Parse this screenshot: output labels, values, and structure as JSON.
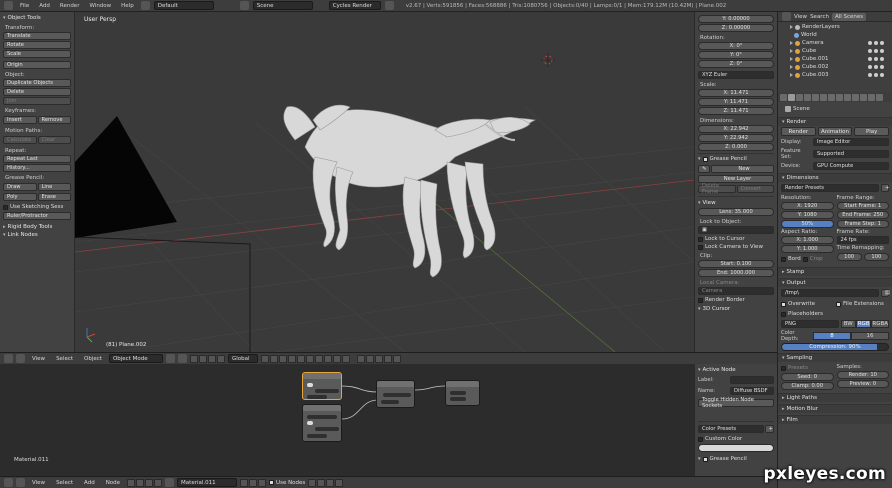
{
  "top_bar": {
    "menus": [
      "File",
      "Add",
      "Render",
      "Window",
      "Help"
    ],
    "layout": "Default",
    "scene": "Scene",
    "engine": "Cycles Render",
    "info": "v2.67 | Verts:591856 | Faces:568886 | Tris:1080756 | Objects:0/40 | Lamps:0/1 | Mem:179.12M (10.42M) | Plane.002"
  },
  "tool_shelf": {
    "object_tools": "Object Tools",
    "transform_label": "Transform:",
    "transform_buttons": [
      "Translate",
      "Rotate",
      "Scale"
    ],
    "origin": "Origin",
    "object_label": "Object:",
    "object_buttons": [
      "Duplicate Objects",
      "Delete",
      "Join"
    ],
    "keyframes_label": "Keyframes:",
    "insert": "Insert",
    "remove": "Remove",
    "motion_label": "Motion Paths:",
    "calculate": "Calculate",
    "clear": "Clear",
    "repeat_label": "Repeat:",
    "repeat_last": "Repeat Last",
    "history": "History...",
    "grease_label": "Grease Pencil:",
    "draw": "Draw",
    "line": "Line",
    "poly": "Poly",
    "erase": "Erase",
    "use_sketching": "Use Sketching Sess",
    "ruler": "Ruler/Protractor",
    "rigid": "Rigid Body Tools",
    "link_nodes": "Link Nodes"
  },
  "viewport": {
    "title": "User Persp",
    "object_label": "(81) Plane.002"
  },
  "viewport_header": {
    "view": "View",
    "select": "Select",
    "object": "Object",
    "mode": "Object Mode",
    "pivot": "Global"
  },
  "n_panel": {
    "loc_y": "Y: 0.00000",
    "loc_z": "Z: 0.00000",
    "rotation": "Rotation:",
    "rot": [
      "X: 0°",
      "Y: 0°",
      "Z: 0°"
    ],
    "euler": "XYZ Euler",
    "scale": "Scale:",
    "scale_vals": [
      "X: 11.471",
      "Y: 11.471",
      "Z: 11.471"
    ],
    "dimensions": "Dimensions:",
    "dim_vals": [
      "X: 22.942",
      "Y: 22.942",
      "Z: 0.000"
    ],
    "grease_pencil": "Grease Pencil",
    "new": "New",
    "new_layer": "New Layer",
    "delete_frame": "Delete Frame",
    "convert": "Convert",
    "view": "View",
    "lens": "Lens: 35.000",
    "lock_to_object": "Lock to Object:",
    "lock_to_cursor": "Lock to Cursor",
    "lock_camera": "Lock Camera to View",
    "clip": "Clip:",
    "clip_start": "Start: 0.100",
    "clip_end": "End: 1000.000",
    "local_camera": "Local Camera:",
    "camera": "Camera",
    "render_border": "Render Border",
    "cursor_3d": "3D Cursor"
  },
  "node_editor": {
    "material_label": "Material.011"
  },
  "node_panel": {
    "active_node": "Active Node",
    "label_k": "Label:",
    "name_k": "Name:",
    "name_v": "Diffuse BSDF",
    "toggle_hidden": "Toggle Hidden Node Sockets",
    "color_presets": "Color Presets",
    "custom_color": "Custom Color",
    "grease_pencil": "Grease Pencil"
  },
  "bottom_bar": {
    "view": "View",
    "select": "Select",
    "add": "Add",
    "node": "Node",
    "material": "Material.011",
    "use_nodes": "Use Nodes"
  },
  "outliner": {
    "view": "View",
    "search": "Search",
    "all_scenes": "All Scenes",
    "items": [
      "RenderLayers",
      "World",
      "Camera",
      "Cube",
      "Cube.001",
      "Cube.002",
      "Cube.003"
    ]
  },
  "properties": {
    "scene": "Scene",
    "render": "Render",
    "render_btn": "Render",
    "animation_btn": "Animation",
    "play_btn": "Play",
    "display_k": "Display:",
    "display_v": "Image Editor",
    "feature_k": "Feature Set:",
    "feature_v": "Supported",
    "device_k": "Device:",
    "device_v": "GPU Compute",
    "dimensions": "Dimensions",
    "presets": "Render Presets",
    "resolution": "Resolution:",
    "res_x": "X: 1920",
    "res_y": "Y: 1080",
    "res_pct": "50%",
    "frame_range": "Frame Range:",
    "start_frame": "Start Frame: 1",
    "end_frame": "End Frame: 250",
    "frame_step": "Frame Step: 1",
    "aspect": "Aspect Ratio:",
    "asp_x": "X: 1.000",
    "asp_y": "Y: 1.000",
    "frame_rate": "Frame Rate:",
    "fps": "24 fps",
    "time_remap": "Time Remapping:",
    "remap_a": "100",
    "remap_b": "100",
    "border": "Bord",
    "crop": "Crop",
    "stamp": "Stamp",
    "output": "Output",
    "output_path": "/tmp\\",
    "overwrite": "Overwrite",
    "file_ext": "File Extensions",
    "placeholders": "Placeholders",
    "format": "PNG",
    "bw": "BW",
    "rgb": "RGB",
    "rgba": "RGBA",
    "color_depth": "Color Depth:",
    "depth_8": "8",
    "depth_16": "16",
    "compression": "Compression: 90%",
    "compression_level": 0.9,
    "sampling": "Sampling",
    "presets_label": "Presets",
    "samples": "Samples:",
    "seed": "Seed: 0",
    "clamp": "Clamp: 0.00",
    "render_samples": "Render: 10",
    "preview_samples": "Preview: 0",
    "light_paths": "Light Paths",
    "motion_blur": "Motion Blur",
    "film": "Film"
  },
  "watermark": "pxleyes.com"
}
